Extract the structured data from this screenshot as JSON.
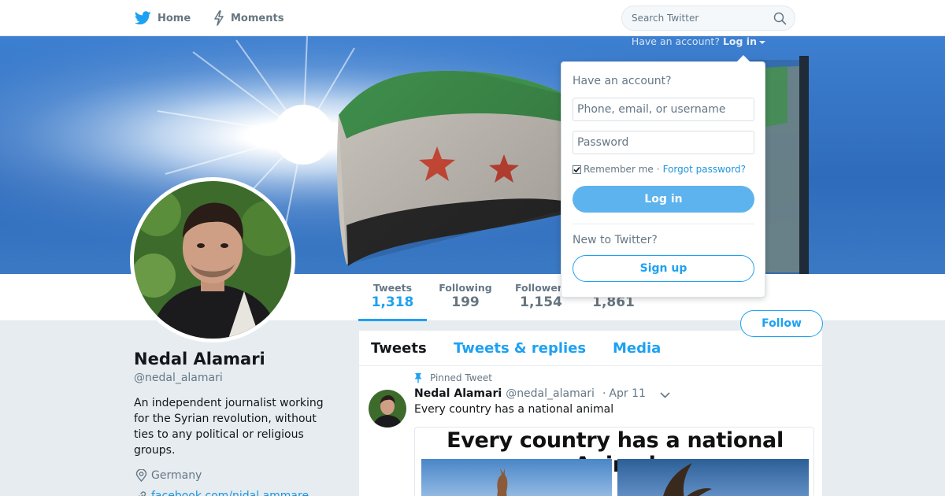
{
  "nav": {
    "home_label": "Home",
    "moments_label": "Moments",
    "search_placeholder": "Search Twitter"
  },
  "login_prompt": {
    "text": "Have an account?",
    "link": "Log in"
  },
  "login_dropdown": {
    "title": "Have an account?",
    "username_placeholder": "Phone, email, or username",
    "password_placeholder": "Password",
    "remember_label": "Remember me",
    "separator": "·",
    "forgot_label": "Forgot password?",
    "login_button": "Log in",
    "new_label": "New to Twitter?",
    "signup_button": "Sign up",
    "remember_checked": true
  },
  "profile": {
    "name": "Nedal Alamari",
    "handle": "@nedal_alamari",
    "bio": "An independent journalist working for the Syrian revolution, without ties to any political or religious groups.",
    "location": "Germany",
    "link": "facebook.com/nidal.ammare"
  },
  "stats": {
    "tweets_label": "Tweets",
    "tweets_value": "1,318",
    "following_label": "Following",
    "following_value": "199",
    "followers_label": "Followers",
    "followers_value": "1,154",
    "likes_value": "1,861"
  },
  "follow_button": "Follow",
  "timeline": {
    "tabs": [
      "Tweets",
      "Tweets & replies",
      "Media"
    ],
    "pinned_label": "Pinned Tweet",
    "tweet": {
      "name": "Nedal Alamari",
      "handle": "@nedal_alamari",
      "separator": "·",
      "time": "Apr 11",
      "text": "Every country has a national animal",
      "media_heading": "Every country has a national Animal"
    }
  },
  "colors": {
    "accent": "#1da1f2",
    "background": "#e6ecf0",
    "login_button": "#5db3ed"
  }
}
